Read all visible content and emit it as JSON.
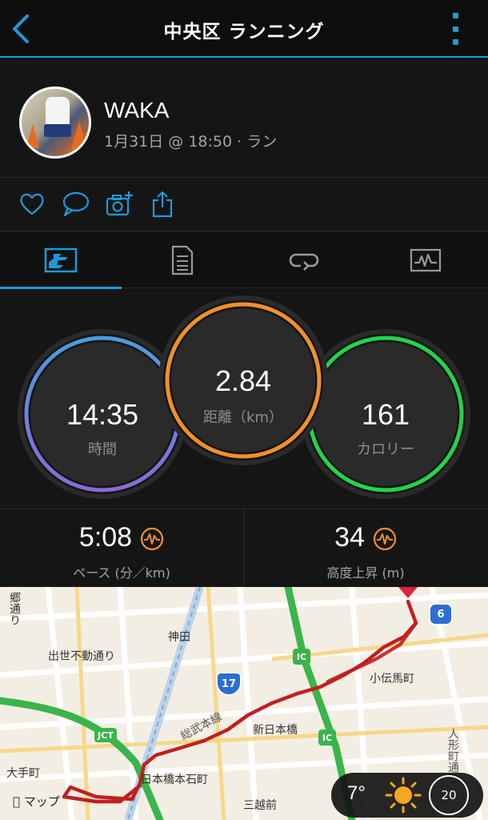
{
  "header": {
    "title": "中央区 ランニング"
  },
  "profile": {
    "name": "WAKA",
    "subline": "1月31日 @ 18:50 · ラン"
  },
  "actions": [
    "heart-icon",
    "comment-icon",
    "camera-add-icon",
    "share-icon"
  ],
  "tabs": [
    {
      "name": "overview",
      "icon": "stats-icon",
      "active": true
    },
    {
      "name": "details",
      "icon": "document-icon",
      "active": false
    },
    {
      "name": "laps",
      "icon": "loop-icon",
      "active": false
    },
    {
      "name": "charts",
      "icon": "chart-icon",
      "active": false
    }
  ],
  "stats": {
    "time": {
      "value": "14:35",
      "label": "時間",
      "color": "#4a7fd6"
    },
    "distance": {
      "value": "2.84",
      "label": "距離（km）",
      "color": "#f0902a"
    },
    "calories": {
      "value": "161",
      "label": "カロリー",
      "color": "#23d34a"
    }
  },
  "metrics": {
    "pace": {
      "value": "5:08",
      "label": "ペース (分／km)"
    },
    "elevation": {
      "value": "34",
      "label": "高度上昇 (m)"
    }
  },
  "map": {
    "labels": {
      "hongo": "郷通り",
      "kanda": "神田",
      "shusse": "出世不動通り",
      "kodenmacho": "小伝馬町",
      "shinnihonbashi": "新日本橋",
      "sobu": "総武本線",
      "nihonbashi_honishi": "日本橋本石町",
      "otemachi": "大手町",
      "mitsukoshimae": "三越前",
      "ningyocho": "人形町通り",
      "jct": "JCT",
      "ic": "IC"
    },
    "route_shields": {
      "r6": "6",
      "r17": "17"
    },
    "logo": "マップ"
  },
  "weather": {
    "temp": "7°",
    "wind": "20",
    "icon": "sun-icon"
  }
}
